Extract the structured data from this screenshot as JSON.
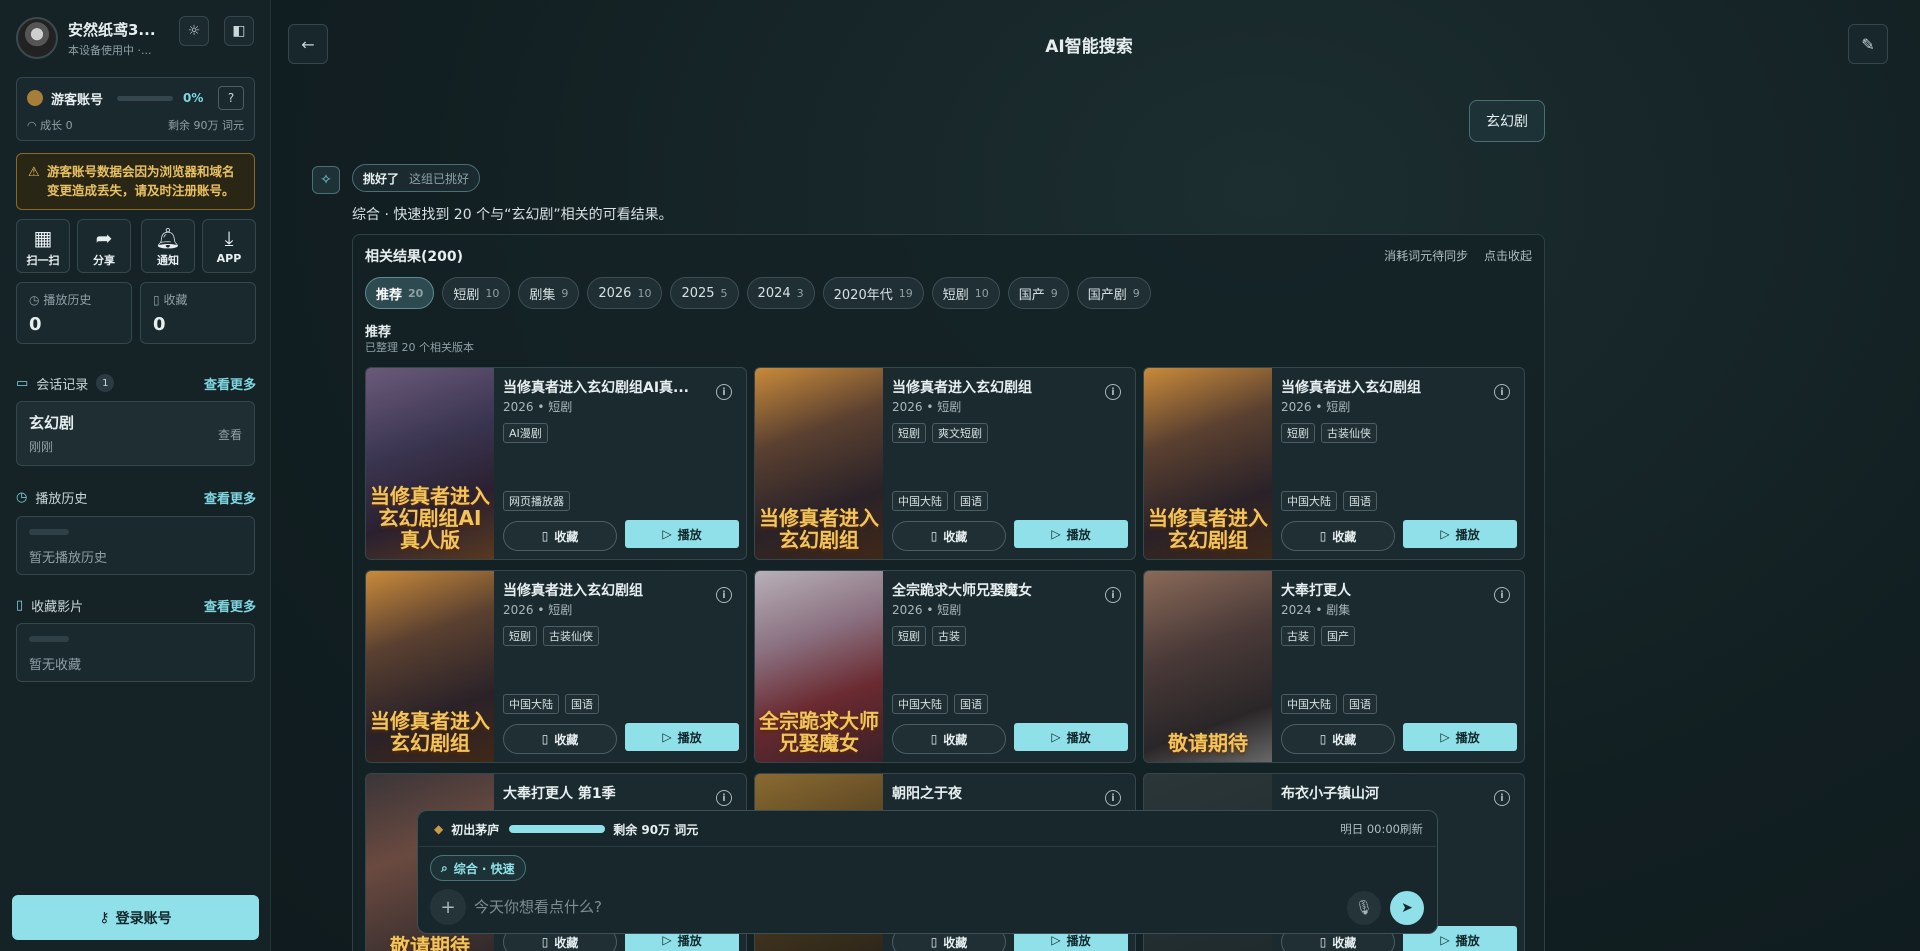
{
  "sidebar": {
    "profile": {
      "name": "安然纸鸢3...",
      "subtitle": "本设备使用中 ·..."
    },
    "guest": {
      "label": "游客账号",
      "progress_pct": "0%",
      "progress_value": 0,
      "growth": "成长 0",
      "remaining": "剩余 90万 词元"
    },
    "warning": "游客账号数据会因为浏览器和域名变更造成丢失，请及时注册账号。",
    "quick_actions": [
      {
        "label": "扫一扫",
        "icon": "qrcode-icon"
      },
      {
        "label": "分享",
        "icon": "share-icon"
      },
      {
        "label": "通知",
        "icon": "bell-icon"
      },
      {
        "label": "APP",
        "icon": "download-icon"
      }
    ],
    "stats": [
      {
        "label": "播放历史",
        "value": "0"
      },
      {
        "label": "收藏",
        "value": "0"
      }
    ],
    "sessions": {
      "title": "会话记录",
      "count": "1",
      "more": "查看更多",
      "items": [
        {
          "title": "玄幻剧",
          "time": "刚刚",
          "action": "查看"
        }
      ]
    },
    "history": {
      "title": "播放历史",
      "more": "查看更多",
      "empty": "暂无播放历史"
    },
    "favorites": {
      "title": "收藏影片",
      "more": "查看更多",
      "empty": "暂无收藏"
    },
    "login": "登录账号"
  },
  "main": {
    "title": "AI智能搜索",
    "user_query": "玄幻剧",
    "done_chip": {
      "label": "挑好了",
      "sub": "这组已挑好"
    },
    "summary": "综合 · 快速找到 20 个与“玄幻剧”相关的可看结果。",
    "results": {
      "title": "相关结果(200)",
      "sync": "消耗词元待同步",
      "collapse": "点击收起",
      "filters": [
        {
          "label": "推荐",
          "count": "20",
          "active": true
        },
        {
          "label": "短剧",
          "count": "10"
        },
        {
          "label": "剧集",
          "count": "9"
        },
        {
          "label": "2026",
          "count": "10"
        },
        {
          "label": "2025",
          "count": "5"
        },
        {
          "label": "2024",
          "count": "3"
        },
        {
          "label": "2020年代",
          "count": "19"
        },
        {
          "label": "短剧",
          "count": "10"
        },
        {
          "label": "国产",
          "count": "9"
        },
        {
          "label": "国产剧",
          "count": "9"
        }
      ],
      "group_title": "推荐",
      "group_sub": "已整理 20 个相关版本",
      "fav_label": "收藏",
      "play_label": "播放",
      "cards": [
        {
          "title": "当修真者进入玄幻剧组AI真...",
          "meta": "2026 • 短剧",
          "tags": [
            "AI漫剧"
          ],
          "bottom_tags": [
            "网页播放器"
          ],
          "poster_text": "当修真者进入玄幻剧组AI真人版"
        },
        {
          "title": "当修真者进入玄幻剧组",
          "meta": "2026 • 短剧",
          "tags": [
            "短剧",
            "爽文短剧"
          ],
          "bottom_tags": [
            "中国大陆",
            "国语"
          ],
          "poster_text": "当修真者进入玄幻剧组"
        },
        {
          "title": "当修真者进入玄幻剧组",
          "meta": "2026 • 短剧",
          "tags": [
            "短剧",
            "古装仙侠"
          ],
          "bottom_tags": [
            "中国大陆",
            "国语"
          ],
          "poster_text": "当修真者进入玄幻剧组"
        },
        {
          "title": "当修真者进入玄幻剧组",
          "meta": "2026 • 短剧",
          "tags": [
            "短剧",
            "古装仙侠"
          ],
          "bottom_tags": [
            "中国大陆",
            "国语"
          ],
          "poster_text": "当修真者进入玄幻剧组"
        },
        {
          "title": "全宗跪求大师兄娶魔女",
          "meta": "2026 • 短剧",
          "tags": [
            "短剧",
            "古装"
          ],
          "bottom_tags": [
            "中国大陆",
            "国语"
          ],
          "poster_text": "全宗跪求大师兄娶魔女"
        },
        {
          "title": "大奉打更人",
          "meta": "2024 • 剧集",
          "tags": [
            "古装",
            "国产"
          ],
          "bottom_tags": [
            "中国大陆",
            "国语"
          ],
          "poster_text": "敬请期待"
        },
        {
          "title": "大奉打更人 第1季",
          "meta": "",
          "tags": [],
          "bottom_tags": [],
          "poster_text": "敬请期待"
        },
        {
          "title": "朝阳之于夜",
          "meta": "",
          "tags": [],
          "bottom_tags": [],
          "poster_text": ""
        },
        {
          "title": "布衣小子镇山河",
          "meta": "",
          "tags": [],
          "bottom_tags": [],
          "poster_text": ""
        }
      ]
    },
    "input": {
      "level": "初出茅庐",
      "level_progress": 1.0,
      "remaining": "剩余 90万 词元",
      "refresh": "明日 00:00刷新",
      "mode": "综合 · 快速",
      "placeholder": "今天你想看点什么?"
    }
  },
  "colors": {
    "accent": "#8fe0e8",
    "warning": "#e8c060",
    "background": "#0f1c20"
  }
}
